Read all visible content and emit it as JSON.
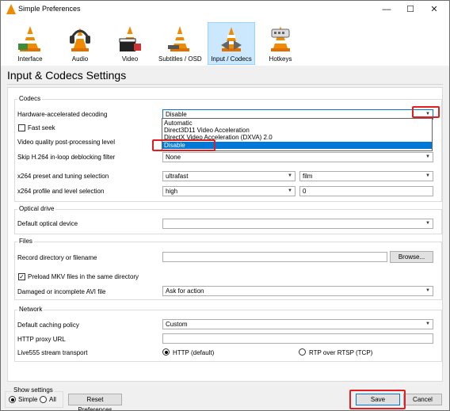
{
  "window": {
    "title": "Simple Preferences"
  },
  "toolbar": {
    "items": [
      {
        "label": "Interface",
        "icon": "interface-cone-icon"
      },
      {
        "label": "Audio",
        "icon": "audio-headphones-icon"
      },
      {
        "label": "Video",
        "icon": "video-clapper-icon"
      },
      {
        "label": "Subtitles / OSD",
        "icon": "subtitles-cone-icon"
      },
      {
        "label": "Input / Codecs",
        "icon": "codecs-cone-icon",
        "selected": true
      },
      {
        "label": "Hotkeys",
        "icon": "hotkeys-cone-icon"
      }
    ]
  },
  "page_title": "Input & Codecs Settings",
  "codecs": {
    "title": "Codecs",
    "hw_decoding_label": "Hardware-accelerated decoding",
    "hw_decoding_value": "Disable",
    "hw_decoding_options": [
      "Automatic",
      "Direct3D11 Video Acceleration",
      "DirectX Video Acceleration (DXVA) 2.0",
      "Disable"
    ],
    "fast_seek_label": "Fast seek",
    "postproc_label": "Video quality post-processing level",
    "skip_h264_label": "Skip H.264 in-loop deblocking filter",
    "skip_h264_value": "None",
    "x264_preset_label": "x264 preset and tuning selection",
    "x264_preset_value": "ultrafast",
    "x264_tune_value": "film",
    "x264_profile_label": "x264 profile and level selection",
    "x264_profile_value": "high",
    "x264_level_value": "0"
  },
  "optical": {
    "title": "Optical drive",
    "device_label": "Default optical device",
    "device_value": ""
  },
  "files": {
    "title": "Files",
    "record_label": "Record directory or filename",
    "record_value": "",
    "browse_label": "Browse...",
    "preload_mkv_label": "Preload MKV files in the same directory",
    "damaged_avi_label": "Damaged or incomplete AVI file",
    "damaged_avi_value": "Ask for action"
  },
  "network": {
    "title": "Network",
    "caching_label": "Default caching policy",
    "caching_value": "Custom",
    "proxy_label": "HTTP proxy URL",
    "proxy_value": "",
    "live555_label": "Live555 stream transport",
    "http_label": "HTTP (default)",
    "rtp_label": "RTP over RTSP (TCP)"
  },
  "footer": {
    "show_settings_label": "Show settings",
    "simple_label": "Simple",
    "all_label": "All",
    "reset_label": "Reset Preferences",
    "save_label": "Save",
    "cancel_label": "Cancel"
  },
  "colors": {
    "highlight": "#0078d7",
    "annotation": "#e02020",
    "vlc_orange": "#f08a00"
  }
}
